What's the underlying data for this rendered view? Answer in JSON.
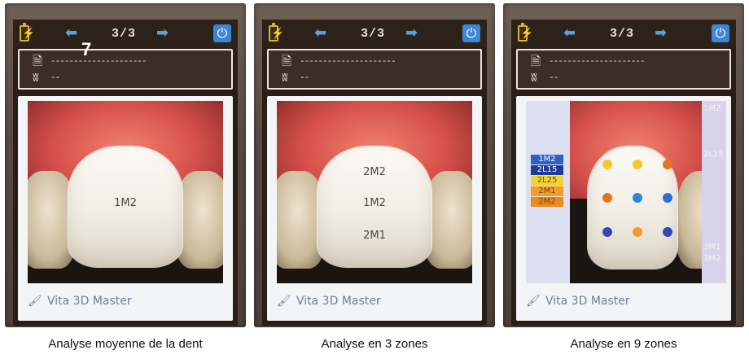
{
  "panels": [
    {
      "pager": "3/3",
      "info": {
        "doc_line": "---------------------",
        "tooth_line": "--"
      },
      "shades": [
        "1M2"
      ],
      "brand": "Vita 3D Master",
      "caption": "Analyse moyenne de la dent",
      "overlay_number": "7"
    },
    {
      "pager": "3/3",
      "info": {
        "doc_line": "---------------------",
        "tooth_line": "--"
      },
      "shades": [
        "2M2",
        "1M2",
        "2M1"
      ],
      "brand": "Vita 3D Master",
      "caption": "Analyse en 3 zones"
    },
    {
      "pager": "3/3",
      "info": {
        "doc_line": "---------------------",
        "tooth_line": "--"
      },
      "legend": [
        {
          "label": "1M2",
          "color": "#2b62c4"
        },
        {
          "label": "2L15",
          "color": "#1f3a99"
        },
        {
          "label": "2L25",
          "color": "#f2d431"
        },
        {
          "label": "2M1",
          "color": "#f29d23"
        },
        {
          "label": "2M2",
          "color": "#e88a20"
        }
      ],
      "right_labels": [
        "1M2",
        "2L15",
        "3M1",
        "3M2"
      ],
      "dot_colors": [
        "#f2c928",
        "#f2c928",
        "#e8731e",
        "#e8731e",
        "#2a86d8",
        "#2a6ed8",
        "#3548b8",
        "#f2992a",
        "#3548b8"
      ],
      "brand": "Vita 3D Master",
      "caption": "Analyse en 9 zones"
    }
  ],
  "icons": {
    "battery": "battery-icon",
    "left": "arrow-left-icon",
    "right": "arrow-right-icon",
    "power": "power-icon",
    "doc": "document-icon",
    "tooth": "tooth-icon",
    "brand": "palette-icon"
  }
}
